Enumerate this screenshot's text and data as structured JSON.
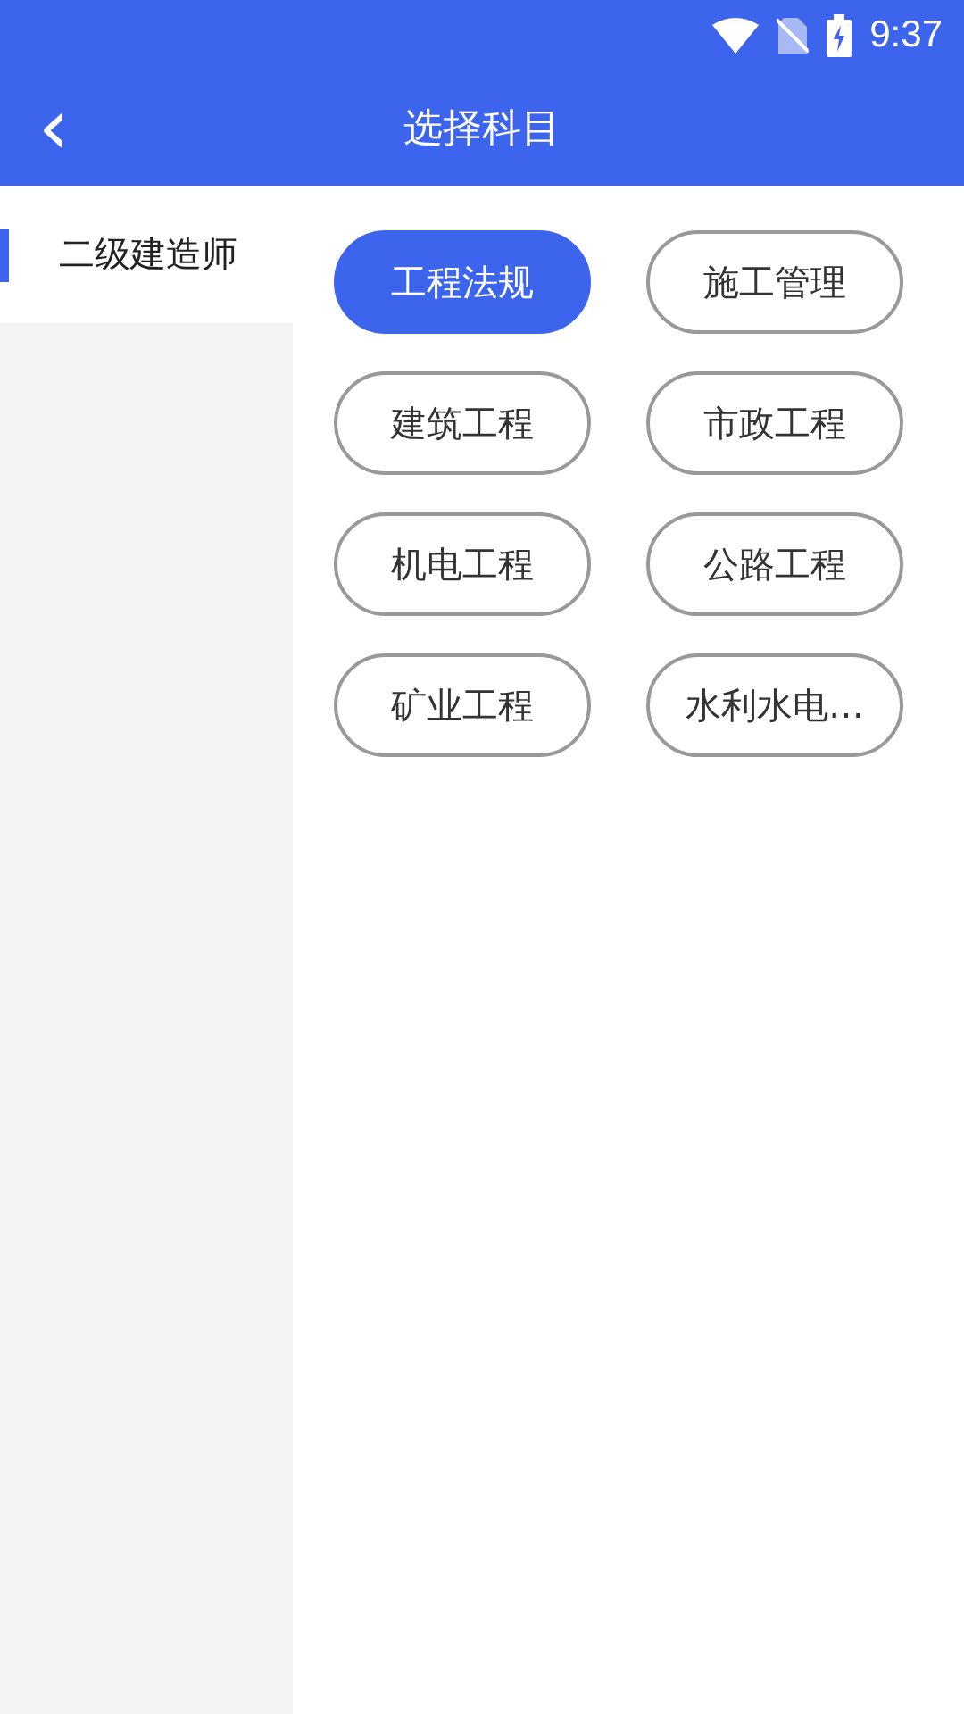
{
  "status_bar": {
    "time": "9:37"
  },
  "header": {
    "back": "‹",
    "title": "选择科目"
  },
  "sidebar": {
    "items": [
      {
        "label": "二级建造师",
        "selected": true
      }
    ]
  },
  "subjects": [
    {
      "label": "工程法规",
      "selected": true
    },
    {
      "label": "施工管理",
      "selected": false
    },
    {
      "label": "建筑工程",
      "selected": false
    },
    {
      "label": "市政工程",
      "selected": false
    },
    {
      "label": "机电工程",
      "selected": false
    },
    {
      "label": "公路工程",
      "selected": false
    },
    {
      "label": "矿业工程",
      "selected": false
    },
    {
      "label": "水利水电…",
      "selected": false
    }
  ]
}
